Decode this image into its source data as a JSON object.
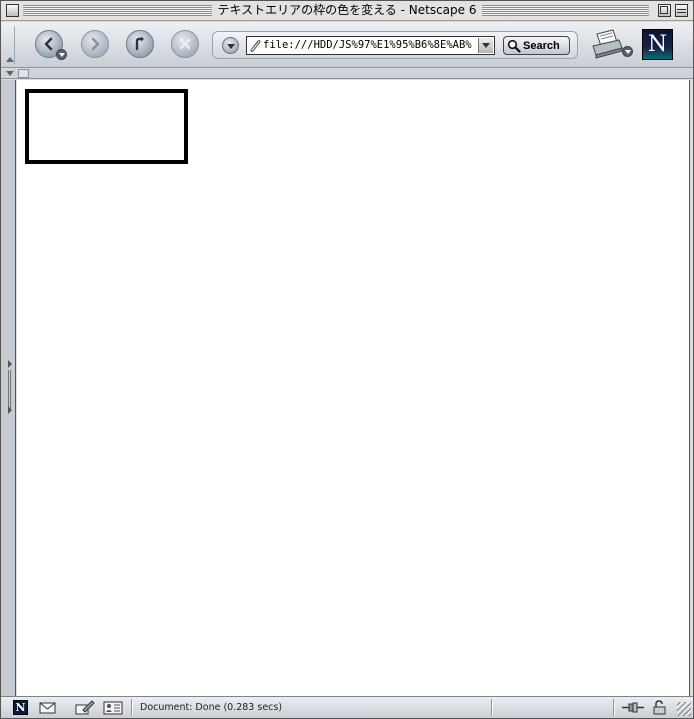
{
  "window": {
    "title": "テキストエリアの枠の色を変える - Netscape 6"
  },
  "toolbar": {
    "back_icon": "back-arrow-icon",
    "forward_icon": "forward-arrow-icon",
    "reload_icon": "reload-icon",
    "stop_icon": "stop-icon",
    "url": "file:///HDD/JS%97%E1%95%B6%8E%AB%",
    "search_label": "Search",
    "print_icon": "print-icon",
    "logo_letter": "N"
  },
  "content": {
    "textarea_value": "",
    "textarea_border_color": "#000000"
  },
  "statusbar": {
    "logo_letter": "N",
    "status_text": "Document: Done (0.283 secs)"
  },
  "colors": {
    "chrome": "#dcdcdc",
    "accent_logo": "#0d1838"
  }
}
